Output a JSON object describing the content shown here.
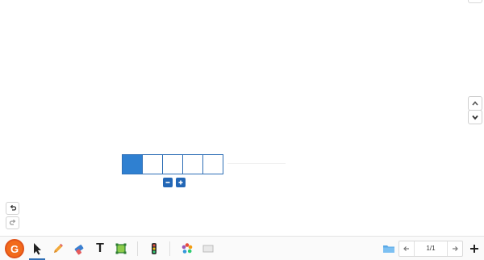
{
  "fraction_bar": {
    "total_parts": 5,
    "filled_parts": 1,
    "fill_color": "#2f80d1",
    "border_color": "#2f6fb6"
  },
  "controls": {
    "minus_icon": "minus-icon",
    "plus_icon": "plus-icon",
    "button_color": "#2367b6"
  },
  "toolbar": {
    "logo_letter": "G",
    "logo_color": "#f26a1b",
    "tools": [
      "pointer-icon",
      "pencil-icon",
      "eraser-icon",
      "text-icon",
      "shape-icon",
      "traffic-light-icon",
      "color-wheel-icon",
      "slides-icon",
      "folder-icon"
    ],
    "text_tool_label": "T",
    "page_indicator": "1/1"
  }
}
